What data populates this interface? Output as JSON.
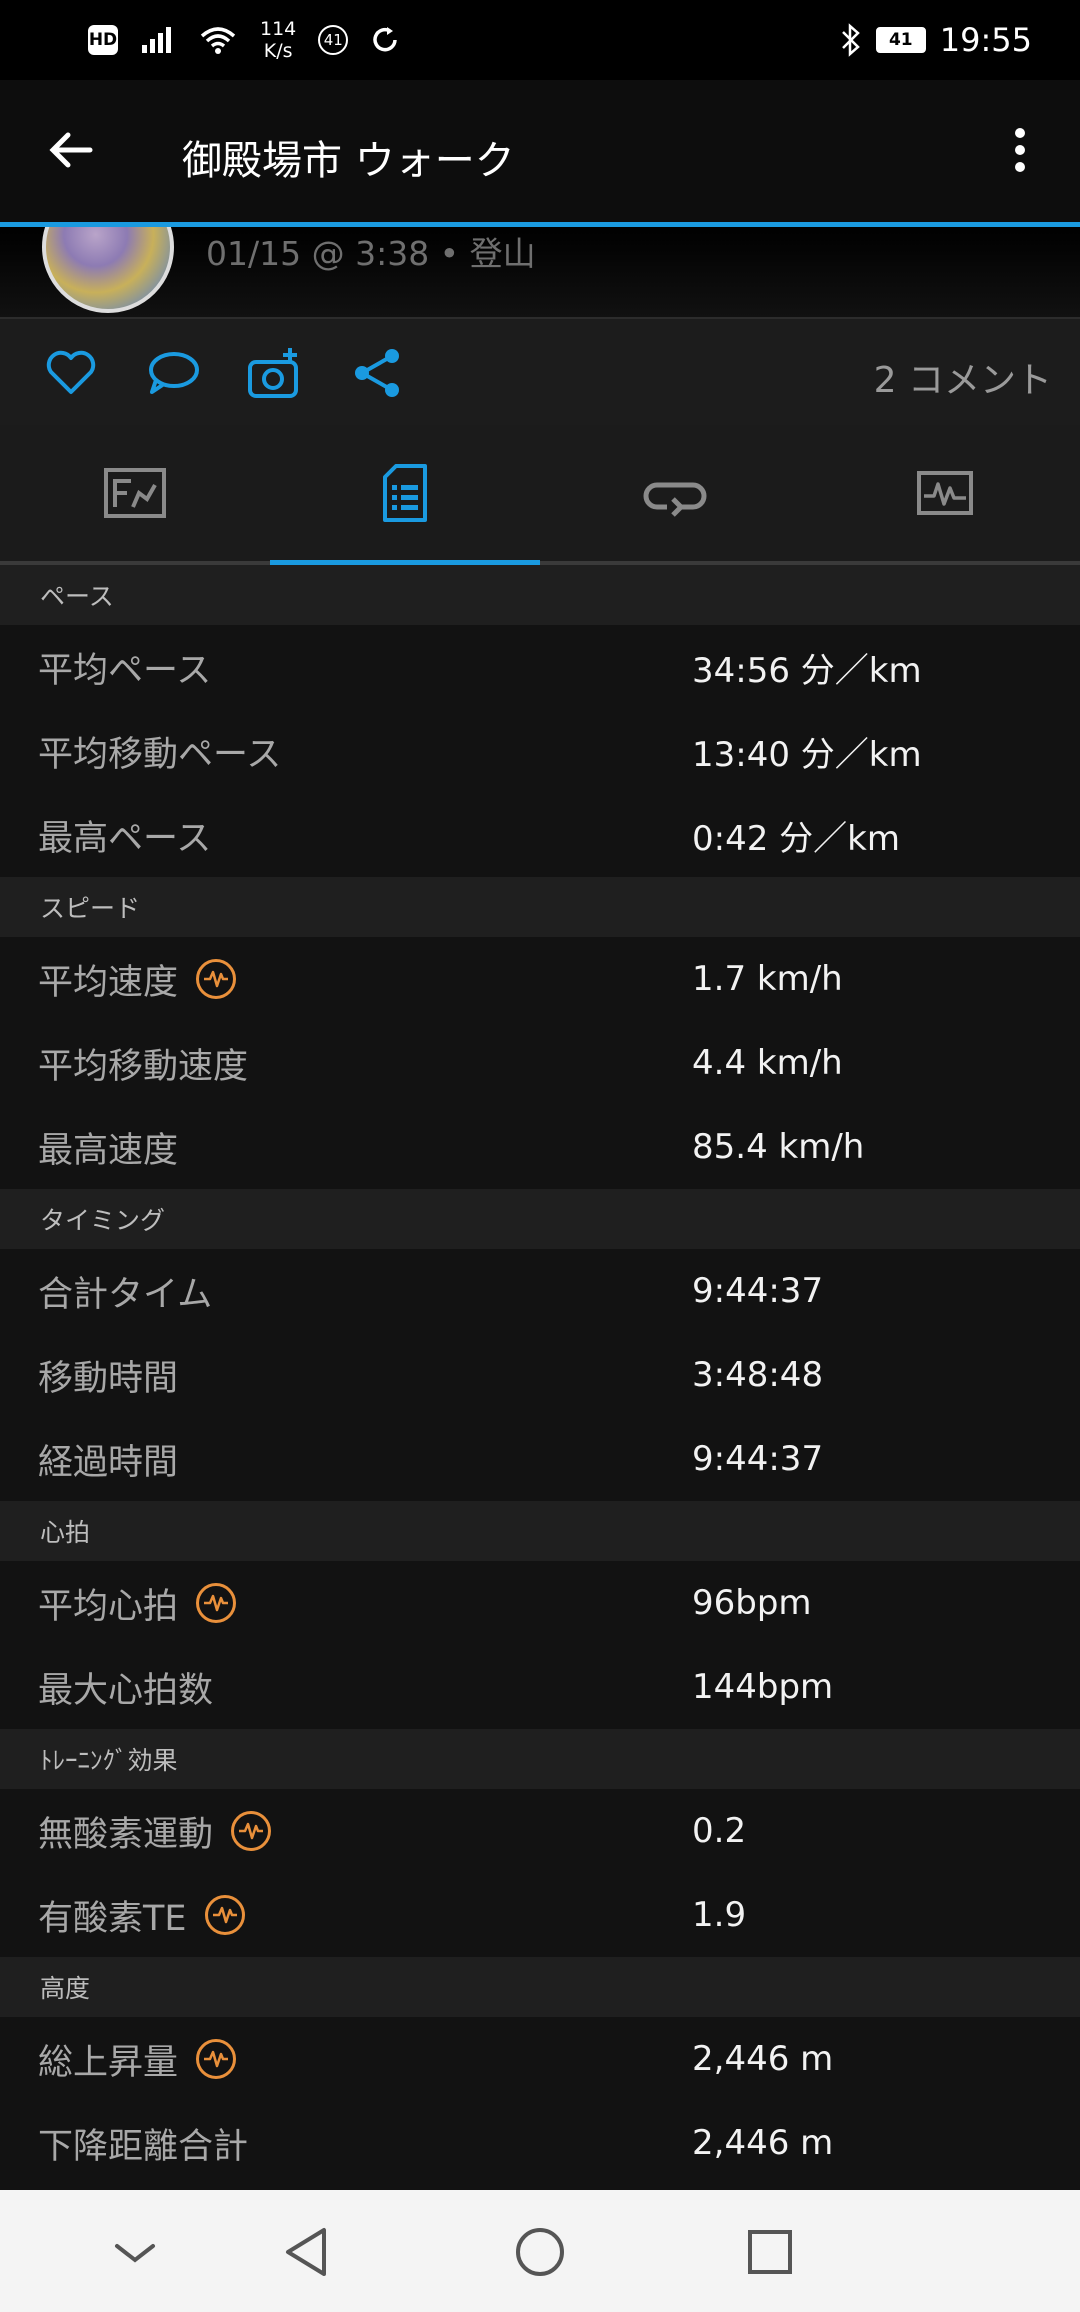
{
  "status_bar": {
    "hd": "HD",
    "speed_value": "114",
    "speed_unit": "K/s",
    "circle_badge": "41",
    "battery": "41",
    "time": "19:55"
  },
  "app_bar": {
    "title": "御殿場市 ウォーク"
  },
  "summary": {
    "date_line": "01/15 @ 3:38 • 登山"
  },
  "actions": {
    "comment_count": "2 コメント"
  },
  "sections": [
    {
      "header": "ペース",
      "rows": [
        {
          "label": "平均ペース",
          "value": "34:56 分／km",
          "badge": false
        },
        {
          "label": "平均移動ペース",
          "value": "13:40 分／km",
          "badge": false
        },
        {
          "label": "最高ペース",
          "value": "0:42 分／km",
          "badge": false
        }
      ]
    },
    {
      "header": "スピード",
      "rows": [
        {
          "label": "平均速度",
          "value": "1.7 km/h",
          "badge": true
        },
        {
          "label": "平均移動速度",
          "value": "4.4 km/h",
          "badge": false
        },
        {
          "label": "最高速度",
          "value": "85.4 km/h",
          "badge": false
        }
      ]
    },
    {
      "header": "タイミング",
      "rows": [
        {
          "label": "合計タイム",
          "value": "9:44:37",
          "badge": false
        },
        {
          "label": "移動時間",
          "value": "3:48:48",
          "badge": false
        },
        {
          "label": "経過時間",
          "value": "9:44:37",
          "badge": false
        }
      ]
    },
    {
      "header": "心拍",
      "rows": [
        {
          "label": "平均心拍",
          "value": "96bpm",
          "badge": true
        },
        {
          "label": "最大心拍数",
          "value": "144bpm",
          "badge": false
        }
      ]
    },
    {
      "header": "ﾄﾚｰﾆﾝｸﾞ効果",
      "rows": [
        {
          "label": "無酸素運動",
          "value": "0.2",
          "badge": true
        },
        {
          "label": "有酸素TE",
          "value": "1.9",
          "badge": true
        }
      ]
    },
    {
      "header": "高度",
      "rows": [
        {
          "label": "総上昇量",
          "value": "2,446 m",
          "badge": true
        },
        {
          "label": "下降距離合計",
          "value": "2,446 m",
          "badge": false
        }
      ]
    }
  ],
  "colors": {
    "accent": "#1a9ae0",
    "badge": "#e9903b"
  }
}
